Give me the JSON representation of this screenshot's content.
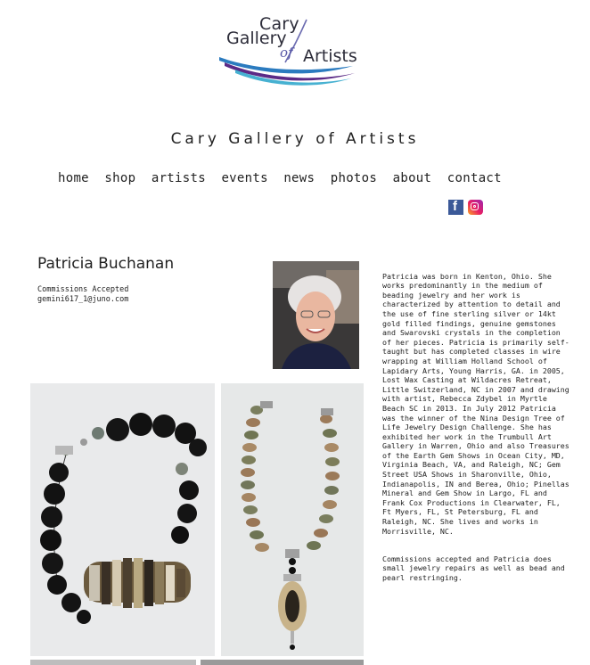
{
  "logo": {
    "line1": "Cary",
    "line2": "Gallery",
    "of": "of",
    "line3": "Artists"
  },
  "site_title": "Cary Gallery of Artists",
  "nav": [
    "home",
    "shop",
    "artists",
    "events",
    "news",
    "photos",
    "about",
    "contact"
  ],
  "social": {
    "facebook_icon": "facebook-icon",
    "instagram_icon": "instagram-icon"
  },
  "artist": {
    "name": "Patricia Buchanan",
    "commissions": "Commissions Accepted",
    "email": "gemini617_1@juno.com",
    "bio_1": "Patricia was born in Kenton, Ohio. She works predominantly in the medium of beading jewelry and her work is characterized by attention to detail and the use of fine sterling silver or 14kt gold filled findings, genuine gemstones and Swarovski crystals in the completion of her pieces. Patricia is primarily self-taught but has completed classes in wire wrapping at William Holland School of Lapidary Arts, Young Harris, GA. in 2005, Lost Wax Casting at Wildacres Retreat, Little Switzerland, NC in 2007 and drawing with artist, Rebecca Zdybel in Myrtle Beach SC in 2013.  In July 2012 Patricia was the winner of the Nina Design Tree of Life Jewelry Design Challenge. She has exhibited her work in the Trumbull Art Gallery in Warren, Ohio and also Treasures of the Earth Gem Shows in Ocean City, MD, Virginia Beach, VA, and Raleigh, NC; Gem Street USA Shows in Sharonville, Ohio, Indianapolis, IN and Berea, Ohio; Pinellas Mineral and Gem Show in Largo, FL and Frank Cox Productions in Clearwater, FL, Ft Myers, FL, St Petersburg, FL and Raleigh, NC. She lives and works in Morrisville, NC.",
    "bio_2": "Commissions accepted and Patricia does small jewelry repairs as well as bead and pearl restringing."
  },
  "colors": {
    "facebook": "#3b5998",
    "logo_purple": "#5b2a86",
    "logo_blue": "#2b7bbf",
    "logo_teal": "#27a3c9"
  }
}
